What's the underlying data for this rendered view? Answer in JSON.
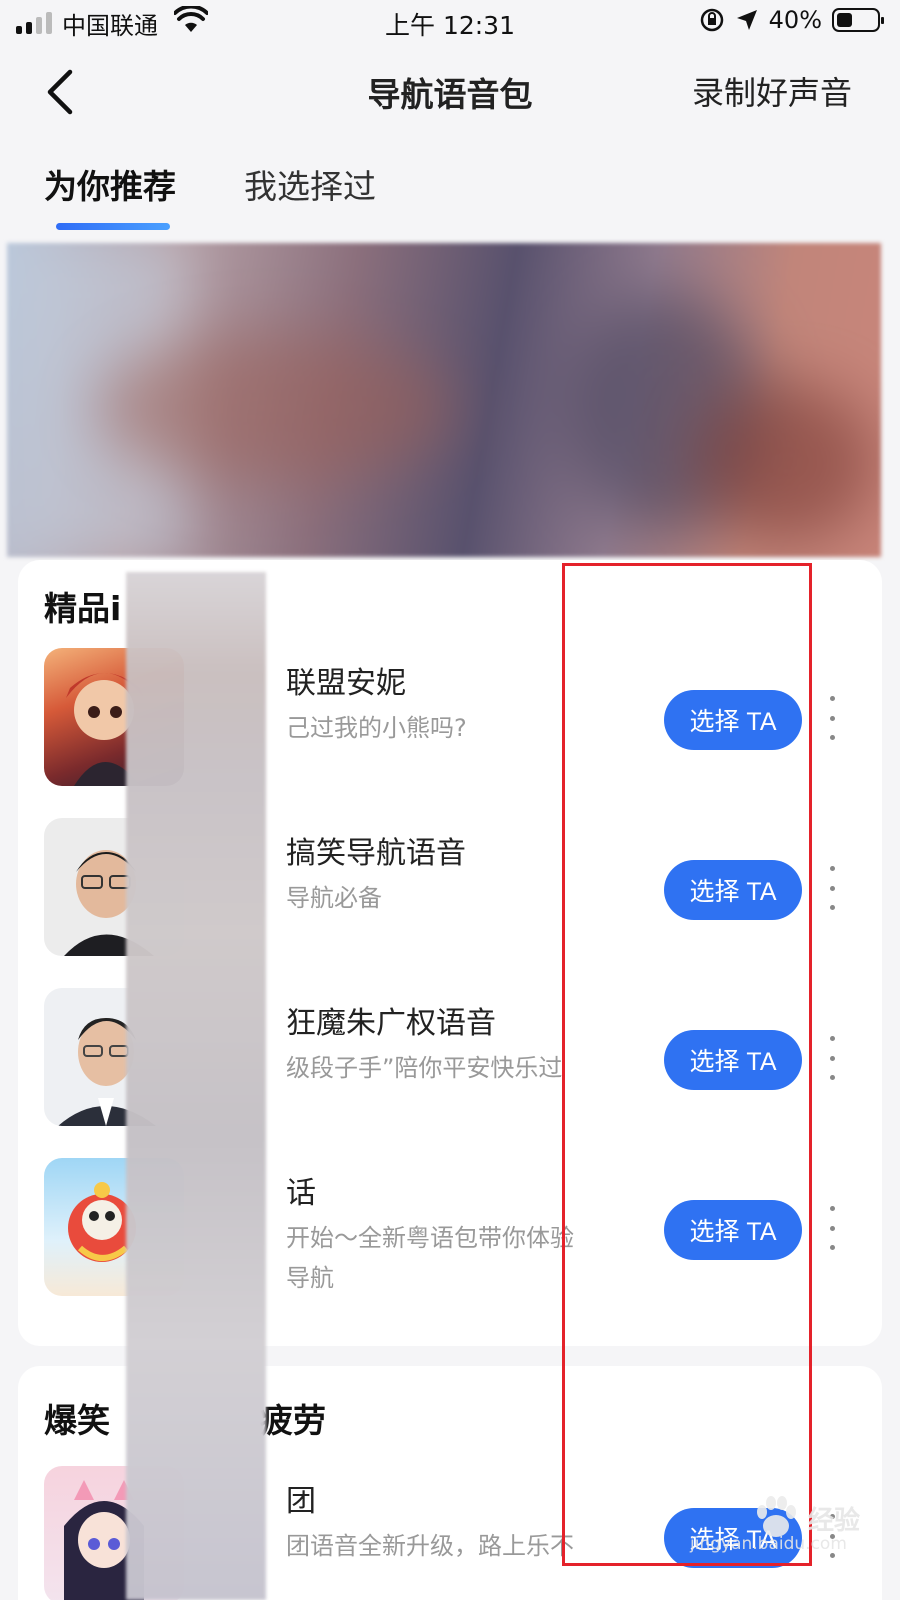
{
  "status_bar": {
    "carrier": "中国联通",
    "time": "上午 12:31",
    "battery": "40%",
    "battery_level": 0.4
  },
  "nav": {
    "title": "导航语音包",
    "right_action": "录制好声音"
  },
  "tabs": [
    {
      "label": "为你推荐",
      "active": true
    },
    {
      "label": "我选择过",
      "active": false
    }
  ],
  "sections": [
    {
      "title": "精品i",
      "items": [
        {
          "title": "联盟安妮",
          "desc": "己过我的小熊吗?",
          "button": "选择 TA",
          "thumb_icon": "annie-avatar"
        },
        {
          "title": "搞笑导航语音",
          "desc": "导航必备",
          "button": "选择 TA",
          "thumb_icon": "man-glasses-avatar"
        },
        {
          "title": "狂魔朱广权语音",
          "desc": "级段子手”陪你平安快乐过",
          "button": "选择 TA",
          "thumb_icon": "host-avatar"
        },
        {
          "title": "话",
          "desc": "开始～全新粤语包带你体验\n导航",
          "button": "选择 TA",
          "thumb_icon": "lion-dance-avatar"
        }
      ]
    },
    {
      "title_left": "爆笑",
      "title_right": "疲劳",
      "items": [
        {
          "title": "团",
          "desc": "团语音全新升级，路上乐不",
          "button": "选择 TA",
          "thumb_icon": "anime-girl-avatar"
        }
      ]
    }
  ],
  "watermark": {
    "text": "经验",
    "url": "jingyan.baidu.com"
  },
  "colors": {
    "accent": "#2f72f2",
    "highlight": "#e4222a"
  }
}
